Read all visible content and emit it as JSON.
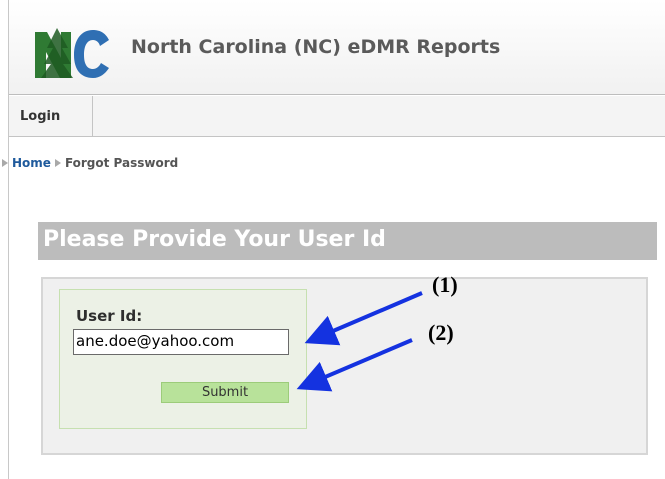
{
  "header": {
    "logo_text": "NC",
    "title": "North Carolina (NC) eDMR Reports"
  },
  "nav": {
    "login_label": "Login"
  },
  "breadcrumb": {
    "home": "Home",
    "current": "Forgot Password"
  },
  "form": {
    "banner_title": "Please Provide Your User Id",
    "userid_label": "User Id:",
    "userid_value": "ane.doe@yahoo.com",
    "submit_label": "Submit"
  },
  "annotations": {
    "callout_1": "(1)",
    "callout_2": "(2)",
    "arrow_color": "#1432e0"
  },
  "colors": {
    "banner": "#bcbcbc",
    "submit_button": "#b8e29a",
    "breadcrumb_link": "#1f5a9c"
  }
}
